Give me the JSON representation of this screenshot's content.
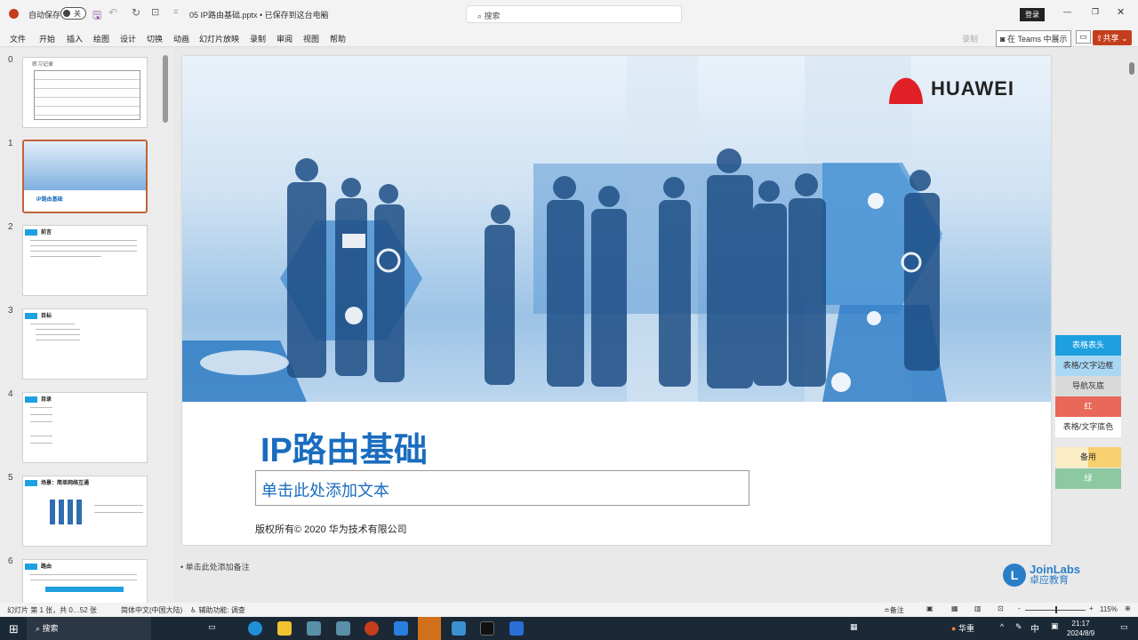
{
  "titlebar": {
    "autosave_label": "自动保存",
    "autosave_state": "关",
    "filename": "05 IP路由基础.pptx • 已保存到这台电脑",
    "search_placeholder": "搜索",
    "signin": "登录"
  },
  "menu": [
    "文件",
    "开始",
    "插入",
    "绘图",
    "设计",
    "切换",
    "动画",
    "幻灯片放映",
    "录制",
    "审阅",
    "视图",
    "帮助"
  ],
  "ribbon_right": {
    "record": "录制",
    "teams": "在 Teams 中展示",
    "share": "共享"
  },
  "thumbnails": [
    {
      "num": "0",
      "title": "练习记录"
    },
    {
      "num": "1",
      "title": "IP路由基础"
    },
    {
      "num": "2",
      "title": "前言"
    },
    {
      "num": "3",
      "title": "目标"
    },
    {
      "num": "4",
      "title": "目录"
    },
    {
      "num": "5",
      "title": "场景：简单网络互通"
    },
    {
      "num": "6",
      "title": "路由"
    }
  ],
  "slide": {
    "logo": "HUAWEI",
    "title": "IP路由基础",
    "subtitle_placeholder": "单击此处添加文本",
    "copyright": "版权所有© 2020 华为技术有限公司"
  },
  "notes_placeholder": "单击此处添加备注",
  "side_panel": [
    {
      "label": "表格表头",
      "color": "#1ea0e0"
    },
    {
      "label": "表格/文字边框",
      "color": "#a9d8f5"
    },
    {
      "label": "导航灰底",
      "color": "#d9d9d9"
    },
    {
      "label": "红",
      "color": "#e8685a"
    },
    {
      "label": "表格/文字底色",
      "color": "#ffffff"
    },
    {
      "label": "备用",
      "color": "#f8d888"
    },
    {
      "label": "绿",
      "color": "#8cc8a0"
    }
  ],
  "watermark": {
    "brand": "JoinLabs",
    "cn": "卓应教育"
  },
  "status": {
    "slide_info": "幻灯片 第 1 张，共 0…52 张",
    "language": "简体中文(中国大陆)",
    "accessibility": "辅助功能: 调查",
    "notes": "备注",
    "zoom": "115%"
  },
  "taskbar": {
    "search": "搜索",
    "weather": "华重",
    "ime": "中",
    "time": "21:17",
    "date": "2024/8/9"
  }
}
